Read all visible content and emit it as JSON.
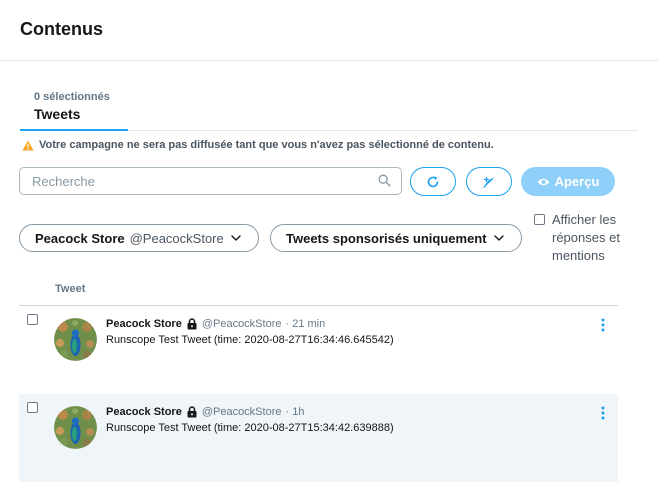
{
  "page": {
    "title": "Contenus"
  },
  "tab": {
    "count_label": "0 sélectionnés",
    "label": "Tweets"
  },
  "warning": {
    "text": "Votre campagne ne sera pas diffusée tant que vous n'avez pas sélectionné de contenu.",
    "icon": "warning-triangle-icon",
    "color": "#f5a623"
  },
  "search": {
    "placeholder": "Recherche",
    "value": "",
    "icon": "search-icon"
  },
  "toolbar": {
    "refresh_icon": "refresh-icon",
    "compose_icon": "compose-tweet-icon",
    "preview_label": "Aperçu",
    "preview_icon": "eye-icon"
  },
  "filters": {
    "account_name": "Peacock Store",
    "account_handle": "@PeacockStore",
    "tweet_type": "Tweets sponsorisés uniquement",
    "show_replies_label": "Afficher les réponses et mentions",
    "show_replies_checked": false
  },
  "table": {
    "column_header": "Tweet",
    "rows": [
      {
        "author": "Peacock Store",
        "handle": "@PeacockStore",
        "time": "· 21 min",
        "text": "Runscope Test Tweet (time: 2020-08-27T16:34:46.645542)",
        "checked": false
      },
      {
        "author": "Peacock Store",
        "handle": "@PeacockStore",
        "time": "· 1h",
        "text": "Runscope Test Tweet (time: 2020-08-27T15:34:42.639888)",
        "checked": false
      }
    ]
  },
  "colors": {
    "accent": "#1da1f2",
    "accent_disabled": "#8ed0f9",
    "warning": "#f5a623",
    "row_alt": "#f0f5f9"
  }
}
